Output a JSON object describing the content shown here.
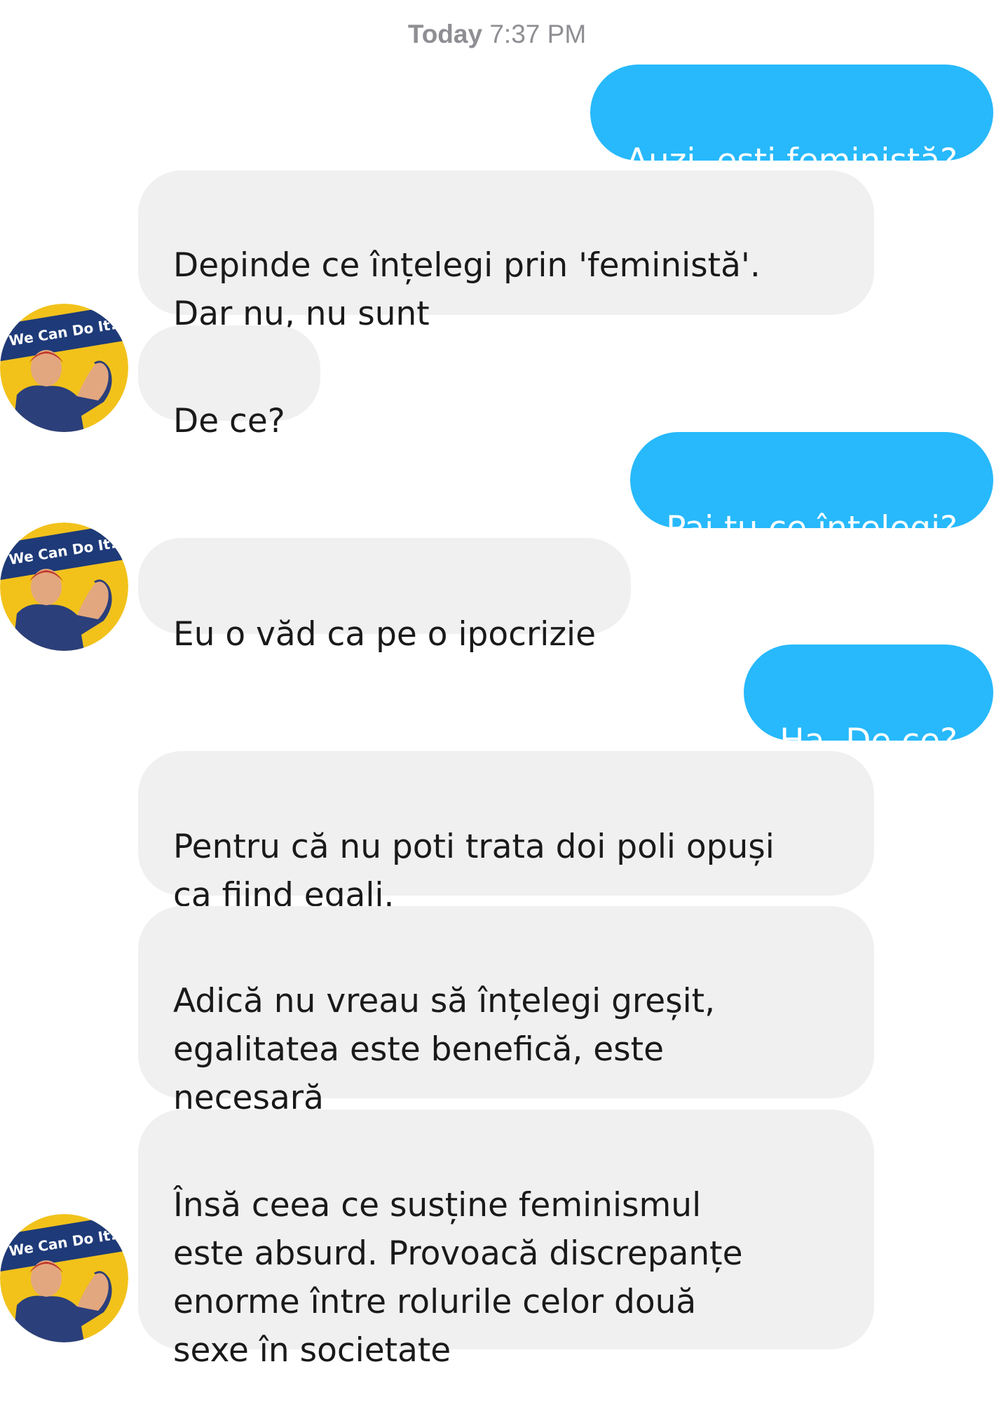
{
  "header": {
    "day": "Today",
    "time": "7:37 PM"
  },
  "avatar": {
    "caption": "We Can Do It!",
    "icon": "we-can-do-it-poster-avatar",
    "colors": {
      "background": "#f2c21b",
      "banner": "#1e3a78",
      "skin": "#e3a77f",
      "shirt": "#2b3f7a"
    }
  },
  "colors": {
    "outgoing_bubble": "#27b9fb",
    "incoming_bubble": "#f0f0f1",
    "timestamp": "#8e8e93"
  },
  "messages": [
    {
      "from": "me",
      "text": "Auzi, ești feministă?"
    },
    {
      "from": "them",
      "text": "Depinde ce înțelegi prin 'feministă'.\nDar nu, nu sunt"
    },
    {
      "from": "them",
      "text": "De ce?"
    },
    {
      "from": "me",
      "text": "Pai tu ce înțelegi?"
    },
    {
      "from": "them",
      "text": "Eu o văd ca pe o ipocrizie"
    },
    {
      "from": "me",
      "text": "Ha. De ce?"
    },
    {
      "from": "them",
      "text": "Pentru că nu poti trata doi poli opuși\nca fiind egali."
    },
    {
      "from": "them",
      "text": "Adică nu vreau să înțelegi greșit,\negalitatea este benefică, este\nnecesară"
    },
    {
      "from": "them",
      "text": "Însă ceea ce susține feminismul\neste absurd. Provoacă discrepanțe\nenorme între rolurile celor două\nsexe în societate"
    }
  ]
}
